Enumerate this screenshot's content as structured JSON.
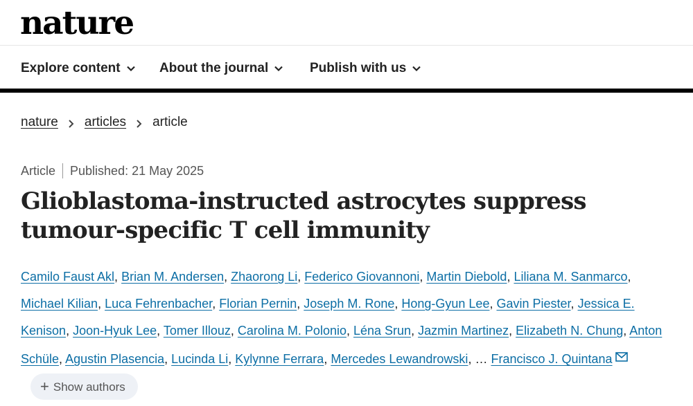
{
  "header": {
    "logo": "nature"
  },
  "nav": {
    "items": [
      {
        "label": "Explore content"
      },
      {
        "label": "About the journal"
      },
      {
        "label": "Publish with us"
      }
    ]
  },
  "breadcrumb": {
    "items": [
      "nature",
      "articles"
    ],
    "current": "article"
  },
  "article": {
    "type": "Article",
    "published": "Published: 21 May 2025",
    "title": "Glioblastoma-instructed astrocytes suppress tumour-specific T cell immunity",
    "authors": [
      "Camilo Faust Akl",
      "Brian M. Andersen",
      "Zhaorong Li",
      "Federico Giovannoni",
      "Martin Diebold",
      "Liliana M. Sanmarco",
      "Michael Kilian",
      "Luca Fehrenbacher",
      "Florian Pernin",
      "Joseph M. Rone",
      "Hong-Gyun Lee",
      "Gavin Piester",
      "Jessica E. Kenison",
      "Joon-Hyuk Lee",
      "Tomer Illouz",
      "Carolina M. Polonio",
      "Léna Srun",
      "Jazmin Martinez",
      "Elizabeth N. Chung",
      "Anton Schüle",
      "Agustin Plasencia",
      "Lucinda Li",
      "Kylynne Ferrara",
      "Mercedes Lewandrowski"
    ],
    "ellipsis": "…",
    "corresponding_author": "Francisco J. Quintana",
    "show_authors_label": "Show authors",
    "mail_icon": "mail-icon"
  },
  "colors": {
    "link": "#0c6ea5",
    "text": "#222222",
    "pill_bg": "#eef1f6"
  }
}
